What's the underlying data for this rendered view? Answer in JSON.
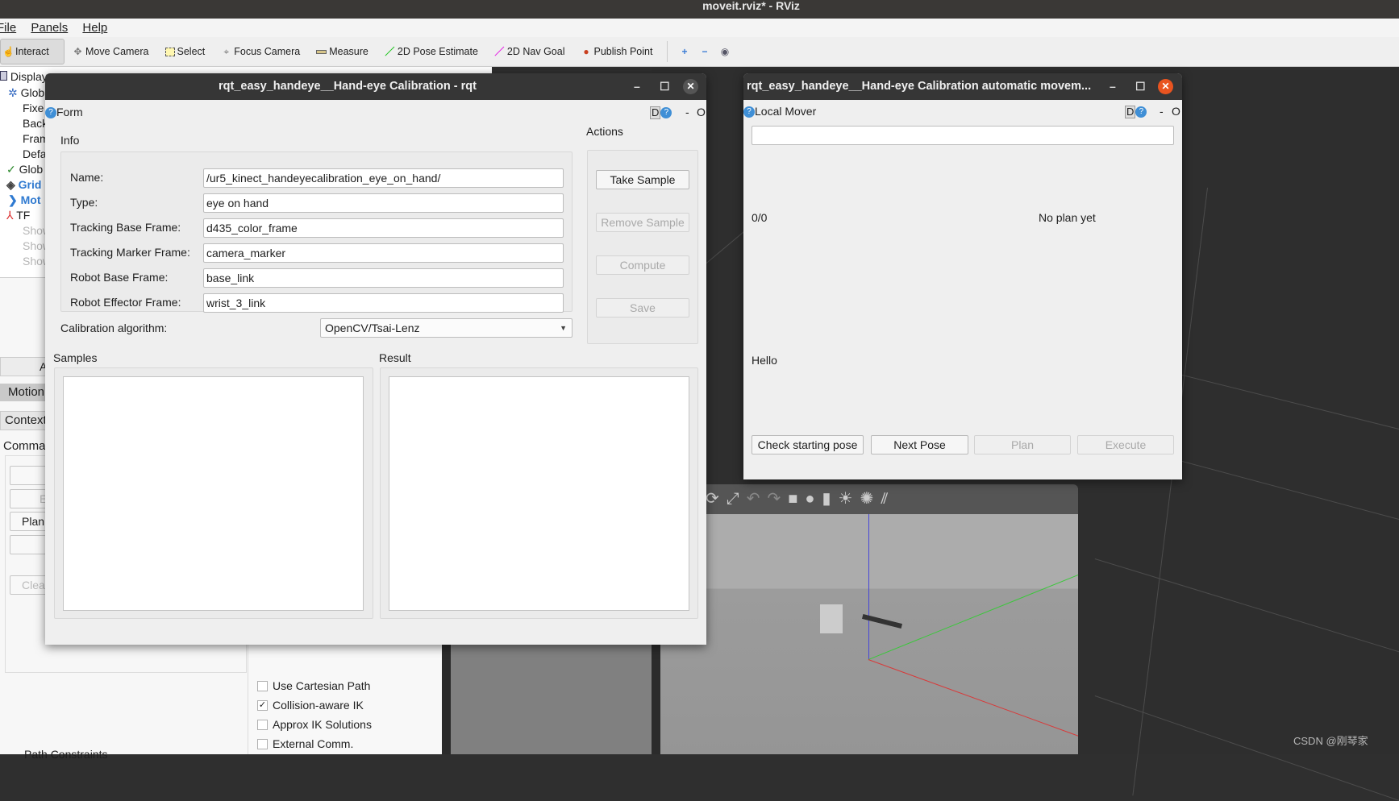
{
  "app": {
    "title": "moveit.rviz* - RViz"
  },
  "menu": [
    "File",
    "Panels",
    "Help"
  ],
  "toolbar": [
    {
      "label": "Interact",
      "icon": "hand-pointer-icon",
      "active": true
    },
    {
      "label": "Move Camera",
      "icon": "move-camera-icon"
    },
    {
      "label": "Select",
      "icon": "select-rectangle-icon"
    },
    {
      "label": "Focus Camera",
      "icon": "focus-camera-icon"
    },
    {
      "label": "Measure",
      "icon": "ruler-icon"
    },
    {
      "label": "2D Pose Estimate",
      "icon": "green-arrow-icon"
    },
    {
      "label": "2D Nav Goal",
      "icon": "magenta-arrow-icon"
    },
    {
      "label": "Publish Point",
      "icon": "map-pin-icon"
    }
  ],
  "left_panel": {
    "displays_header": "Display",
    "tree": [
      "Glob",
      "Fixe",
      "Back",
      "Fram",
      "Defa",
      "Glob",
      "Grid",
      "Mot",
      "TF",
      "Show",
      "Show",
      "Show"
    ],
    "tab_label": "A",
    "motion_tab": "Motion",
    "context_tab": "Context",
    "commands_label": "Comma",
    "buttons": [
      "",
      "E",
      "Plan",
      "",
      "Clea"
    ],
    "checkboxes": [
      {
        "label": "Use Cartesian Path",
        "checked": false
      },
      {
        "label": "Collision-aware IK",
        "checked": true
      },
      {
        "label": "Approx IK Solutions",
        "checked": false
      },
      {
        "label": "External Comm.",
        "checked": false
      }
    ],
    "bottom_label": "Path Constraints"
  },
  "calib_window": {
    "title": "rqt_easy_handeye__Hand-eye Calibration - rqt",
    "plugin": "Form",
    "d_label": "D",
    "dash": "-",
    "o_label": "O",
    "info_label": "Info",
    "fields": [
      {
        "label": "Name:",
        "value": "/ur5_kinect_handeyecalibration_eye_on_hand/"
      },
      {
        "label": "Type:",
        "value": "eye on hand"
      },
      {
        "label": "Tracking Base Frame:",
        "value": "d435_color_frame"
      },
      {
        "label": "Tracking Marker Frame:",
        "value": "camera_marker"
      },
      {
        "label": "Robot Base Frame:",
        "value": "base_link"
      },
      {
        "label": "Robot Effector Frame:",
        "value": "wrist_3_link"
      }
    ],
    "algorithm_label": "Calibration algorithm:",
    "algorithm_value": "OpenCV/Tsai-Lenz",
    "actions_label": "Actions",
    "actions": [
      {
        "label": "Take Sample",
        "enabled": true
      },
      {
        "label": "Remove Sample",
        "enabled": false
      },
      {
        "label": "Compute",
        "enabled": false
      },
      {
        "label": "Save",
        "enabled": false
      }
    ],
    "samples_label": "Samples",
    "result_label": "Result"
  },
  "mover_window": {
    "title": "rqt_easy_handeye__Hand-eye Calibration automatic movem...",
    "plugin": "Local Mover",
    "d_label": "D",
    "dash": "-",
    "o_label": "O",
    "input_value": "",
    "progress": "0/0",
    "plan_status": "No plan yet",
    "message": "Hello",
    "buttons": [
      {
        "label": "Check starting pose",
        "enabled": true
      },
      {
        "label": "Next Pose",
        "enabled": true
      },
      {
        "label": "Plan",
        "enabled": false
      },
      {
        "label": "Execute",
        "enabled": false
      }
    ]
  },
  "watermark": "CSDN @刚琴家",
  "colors": {
    "close_button": "#e95420",
    "titlebar": "#363636",
    "help_icon": "#3f8fd6"
  }
}
